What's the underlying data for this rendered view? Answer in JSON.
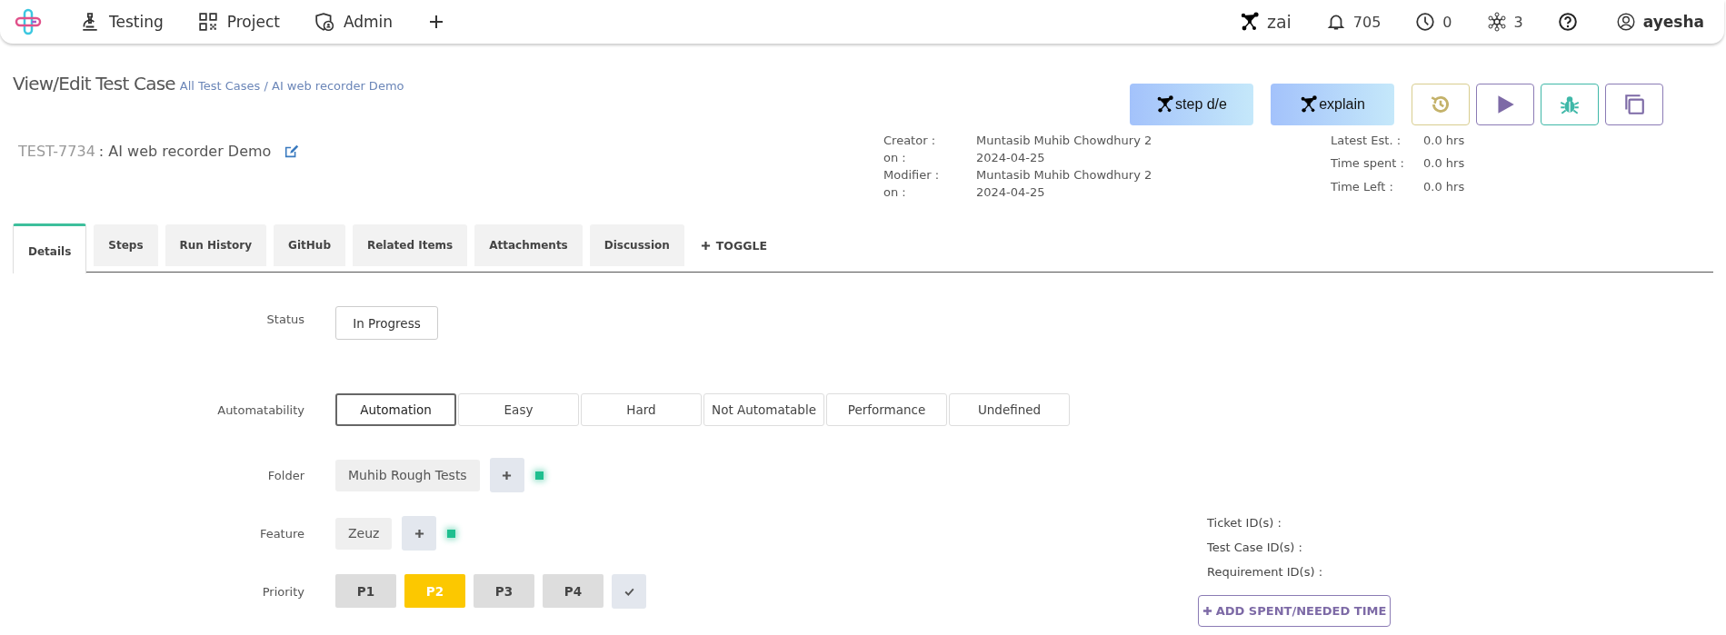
{
  "topbar": {
    "nav": [
      {
        "kind": "testing",
        "label": "Testing"
      },
      {
        "kind": "project",
        "label": "Project"
      },
      {
        "kind": "admin",
        "label": "Admin"
      }
    ],
    "status": [
      {
        "kind": "zai",
        "label": "zai"
      },
      {
        "kind": "bell",
        "label": "705"
      },
      {
        "kind": "clock",
        "label": "0"
      },
      {
        "kind": "hub",
        "label": "3"
      }
    ],
    "user": "ayesha"
  },
  "page": {
    "title": "View/Edit Test Case",
    "breadcrumb": "All Test Cases / AI web recorder Demo"
  },
  "actions": [
    {
      "kind": "ai",
      "label": "step d/e"
    },
    {
      "kind": "ai",
      "label": "explain"
    },
    {
      "kind": "history"
    },
    {
      "kind": "run"
    },
    {
      "kind": "bug"
    },
    {
      "kind": "copy"
    }
  ],
  "test_case": {
    "id": "TEST-7734",
    "name": ": AI web recorder Demo"
  },
  "meta": [
    {
      "label": "Creator :",
      "value": "Muntasib Muhib Chowdhury 2"
    },
    {
      "label": "on :",
      "value": "2024-04-25"
    },
    {
      "label": "Modifier :",
      "value": "Muntasib Muhib Chowdhury 2"
    },
    {
      "label": "on :",
      "value": "2024-04-25"
    }
  ],
  "time": [
    {
      "label": "Latest Est. :",
      "value": "0.0 hrs"
    },
    {
      "label": "Time spent :",
      "value": "0.0 hrs"
    },
    {
      "label": "Time Left :",
      "value": "0.0 hrs"
    }
  ],
  "tabs": [
    {
      "label": "Details",
      "selected": true
    },
    {
      "label": "Steps",
      "selected": false
    },
    {
      "label": "Run History",
      "selected": false
    },
    {
      "label": "GitHub",
      "selected": false
    },
    {
      "label": "Related Items",
      "selected": false
    },
    {
      "label": "Attachments",
      "selected": false
    },
    {
      "label": "Discussion",
      "selected": false
    }
  ],
  "toggle": "TOGGLE",
  "form": {
    "status": {
      "label": "Status",
      "value": "In Progress"
    },
    "automatability": {
      "label": "Automatability",
      "options": [
        {
          "label": "Automation",
          "selected": true
        },
        {
          "label": "Easy",
          "selected": false
        },
        {
          "label": "Hard",
          "selected": false
        },
        {
          "label": "Not Automatable",
          "selected": false
        },
        {
          "label": "Performance",
          "selected": false
        },
        {
          "label": "Undefined",
          "selected": false
        }
      ]
    },
    "folder": {
      "label": "Folder",
      "value": "Muhib Rough Tests"
    },
    "feature": {
      "label": "Feature",
      "value": "Zeuz"
    },
    "priority": {
      "label": "Priority",
      "options": [
        {
          "label": "P1",
          "selected": false
        },
        {
          "label": "P2",
          "selected": true
        },
        {
          "label": "P3",
          "selected": false
        },
        {
          "label": "P4",
          "selected": false
        }
      ]
    }
  },
  "ids": [
    "Ticket ID(s) :",
    "Test Case ID(s) :",
    "Requirement ID(s) :"
  ],
  "add_time": "ADD SPENT/NEEDED TIME"
}
